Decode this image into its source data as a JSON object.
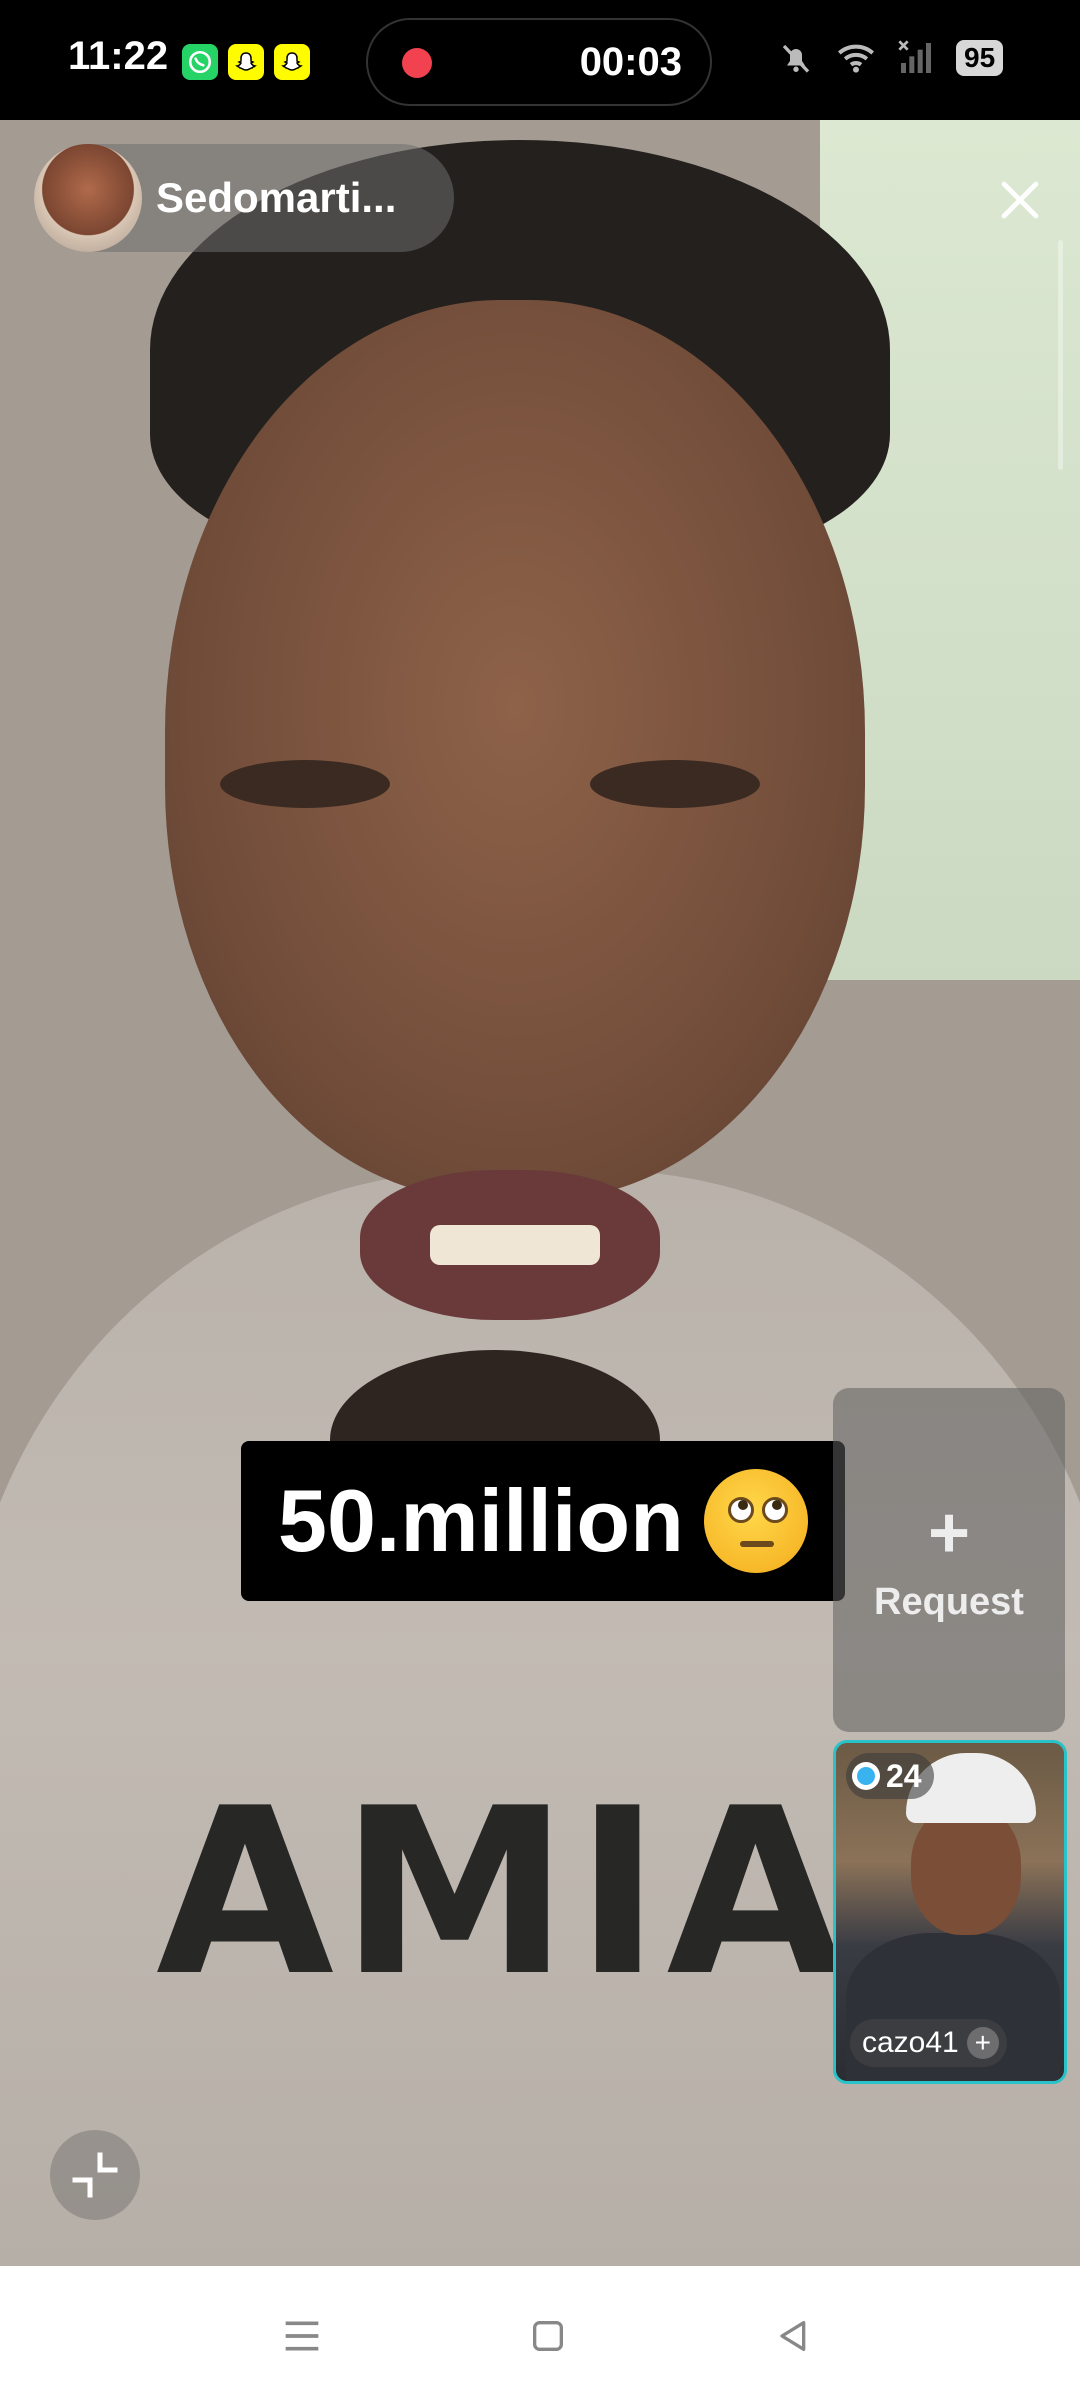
{
  "status_bar": {
    "time": "11:22",
    "apps": [
      "whatsapp-icon",
      "snapchat-icon",
      "snapchat-icon"
    ],
    "recording_timer": "00:03",
    "battery": "95",
    "colors": {
      "record_dot": "#F2424F",
      "whatsapp": "#25D366",
      "snapchat": "#FFFC00"
    }
  },
  "host": {
    "name": "Sedomarti..."
  },
  "caption": {
    "text": "50.million"
  },
  "request": {
    "plus": "+",
    "label": "Request"
  },
  "guest": {
    "count": "24",
    "name": "cazo41",
    "follow": "+"
  },
  "colors": {
    "guest_border": "#28c2c8"
  }
}
